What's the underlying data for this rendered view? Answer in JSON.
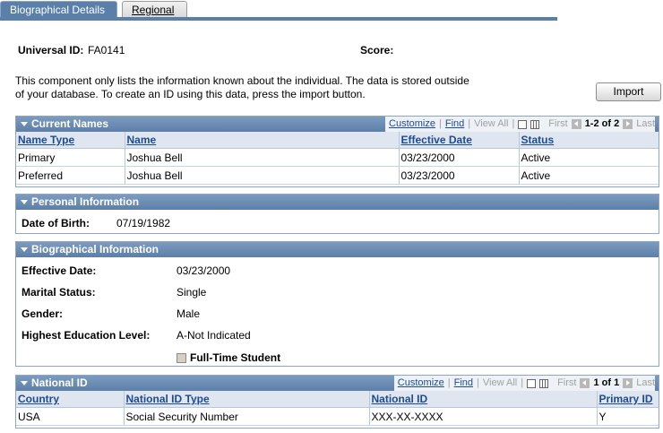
{
  "tabs": [
    {
      "label": "Biographical Details",
      "active": true
    },
    {
      "label": "Regional",
      "active": false
    }
  ],
  "header": {
    "universal_id_label": "Universal ID:",
    "universal_id_value": "FA0141",
    "score_label": "Score:"
  },
  "info_text": {
    "line1": "This component only lists the information known about the individual. The data is stored outside",
    "line2": "of your database. To create an ID using this data, press the import button."
  },
  "import_button": "Import",
  "current_names": {
    "title": "Current Names",
    "nav": {
      "customize": "Customize",
      "find": "Find",
      "view_all": "View All",
      "first": "First",
      "count": "1-2 of 2",
      "last": "Last"
    },
    "columns": [
      "Name Type",
      "Name",
      "Effective Date",
      "Status"
    ],
    "rows": [
      [
        "Primary",
        "Joshua Bell",
        "03/23/2000",
        "Active"
      ],
      [
        "Preferred",
        "Joshua Bell",
        "03/23/2000",
        "Active"
      ]
    ]
  },
  "personal_info": {
    "title": "Personal Information",
    "dob_label": "Date of Birth:",
    "dob_value": "07/19/1982"
  },
  "bio_info": {
    "title": "Biographical Information",
    "effective_date_label": "Effective Date:",
    "effective_date_value": "03/23/2000",
    "marital_label": "Marital Status:",
    "marital_value": "Single",
    "gender_label": "Gender:",
    "gender_value": "Male",
    "education_label": "Highest Education Level:",
    "education_value": "A-Not Indicated",
    "fulltime_label": "Full-Time Student"
  },
  "national_id": {
    "title": "National ID",
    "nav": {
      "customize": "Customize",
      "find": "Find",
      "view_all": "View All",
      "first": "First",
      "count": "1 of 1",
      "last": "Last"
    },
    "columns": [
      "Country",
      "National ID Type",
      "National ID",
      "Primary ID"
    ],
    "rows": [
      [
        "USA",
        "Social Security Number",
        "XXX-XX-XXXX",
        "Y"
      ]
    ]
  },
  "colors": {
    "header_blue": "#5a7fa9",
    "link": "#1c4c8f"
  }
}
